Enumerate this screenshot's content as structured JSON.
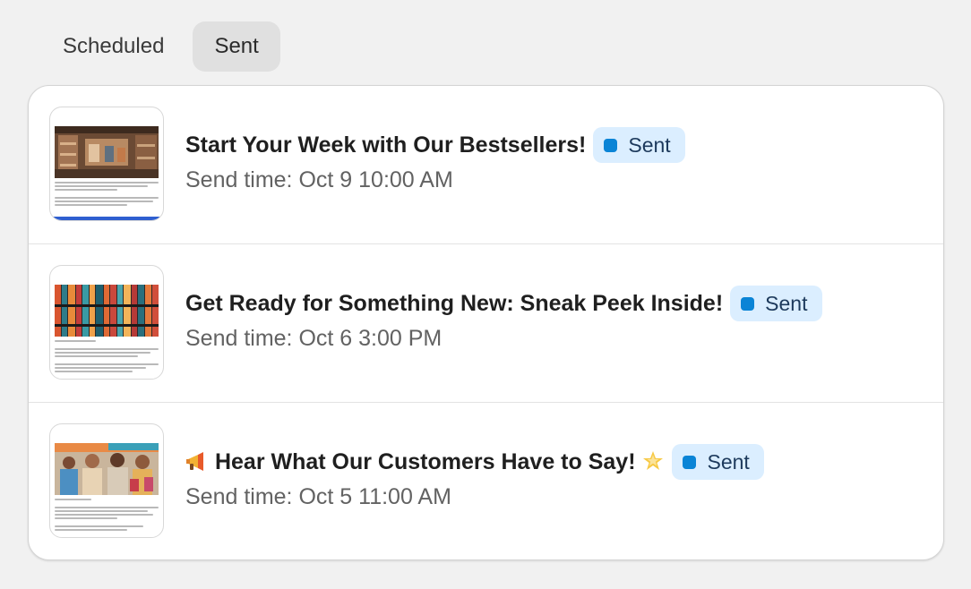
{
  "tabs": [
    {
      "label": "Scheduled",
      "active": false
    },
    {
      "label": "Sent",
      "active": true
    }
  ],
  "campaigns": [
    {
      "title": "Start Your Week with Our Bestsellers!",
      "title_prefix_icon": "",
      "title_suffix_icon": "",
      "status": "Sent",
      "send_time": "Send time: Oct 9 10:00 AM",
      "thumbnail": "store-shelves-image"
    },
    {
      "title": "Get Ready for Something New: Sneak Peek Inside!",
      "title_prefix_icon": "",
      "title_suffix_icon": "",
      "status": "Sent",
      "send_time": "Send time: Oct 6 3:00 PM",
      "thumbnail": "colorful-books-image"
    },
    {
      "title": "Hear What Our Customers Have to Say!",
      "title_prefix_icon": "megaphone-icon",
      "title_suffix_icon": "glowing-star-icon",
      "status": "Sent",
      "send_time": "Send time: Oct 5 11:00 AM",
      "thumbnail": "happy-customers-image"
    }
  ],
  "colors": {
    "status_dot": "#0a84d6",
    "status_bg": "#dbeeff",
    "active_tab_bg": "#e0e0e0"
  }
}
